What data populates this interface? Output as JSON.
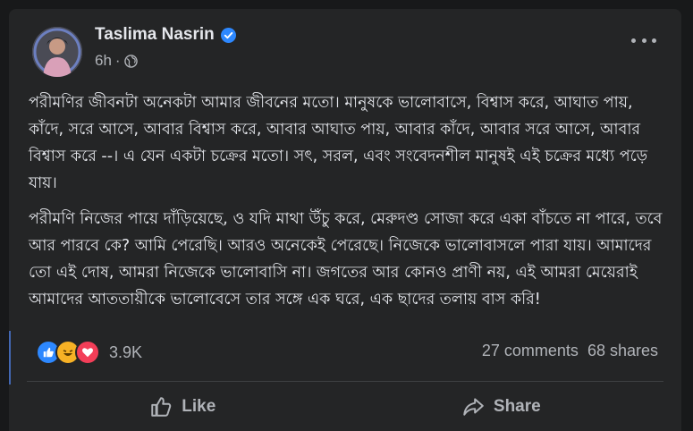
{
  "post": {
    "author": "Taslima Nasrin",
    "time": "6h",
    "paragraphs": [
      "পরীমণির জীবনটা অনেকটা আমার জীবনের মতো। মানুষকে ভালোবাসে, বিশ্বাস করে, আঘাত পায়, কাঁদে, সরে আসে, আবার বিশ্বাস করে, আবার আঘাত পায়, আবার কাঁদে, আবার সরে আসে, আবার বিশ্বাস করে --। এ যেন একটা চক্রের মতো। সৎ, সরল,  এবং সংবেদনশীল মানুষই  এই চক্রের মধ্যে পড়ে যায়।",
      "পরীমণি নিজের পায়ে দাঁড়িয়েছে, ও যদি মাথা উঁচু করে, মেরুদণ্ড সোজা করে একা বাঁচতে না পারে, তবে আর পারবে কে? আমি পেরেছি। আরও অনেকেই পেরেছে। নিজেকে ভালোবাসলে পারা যায়। আমাদের তো এই দোষ, আমরা নিজেকে ভালোবাসি না। জগতের আর কোনও প্রাণী নয়, এই আমরা মেয়েরাই  আমাদের আততায়ীকে ভালোবেসে তার সঙ্গে এক ঘরে, এক ছাদের তলায়  বাস করি!"
    ],
    "reaction_count": "3.9K",
    "comments": "27 comments",
    "shares": "68 shares",
    "actions": {
      "like": "Like",
      "share": "Share"
    }
  },
  "icons": {
    "verified": "verified-badge-icon",
    "globe": "globe-icon",
    "more": "more-options-icon",
    "like": "like-icon",
    "haha": "haha-icon",
    "love": "love-icon",
    "share": "share-icon"
  },
  "colors": {
    "background": "#18191a",
    "card": "#242526",
    "text": "#e4e6eb",
    "secondary": "#b0b3b8",
    "accent": "#2d88ff",
    "love": "#f33e58",
    "haha": "#f7b125"
  }
}
